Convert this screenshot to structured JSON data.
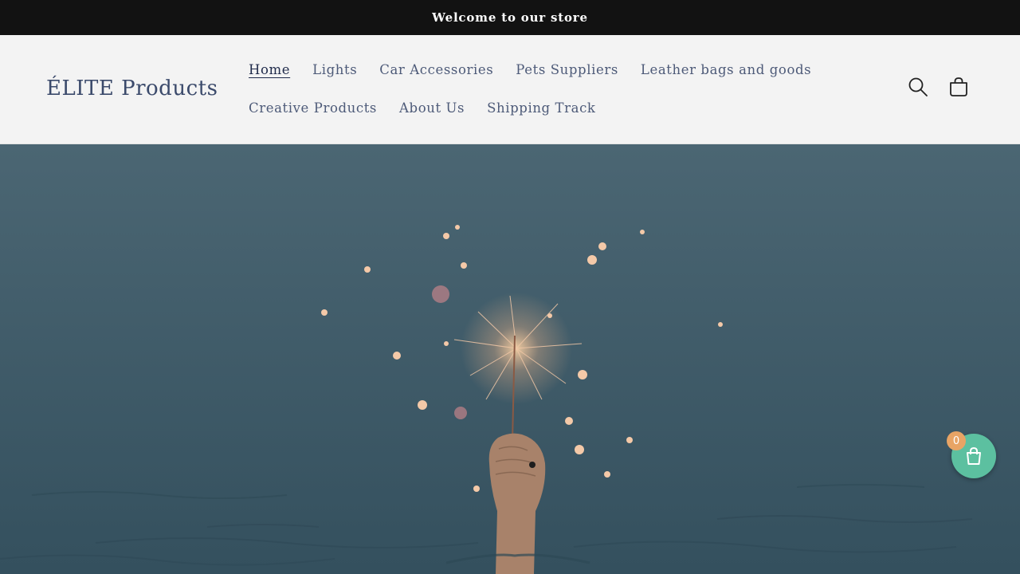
{
  "announcement": {
    "text": "Welcome to our store"
  },
  "header": {
    "logo": "ÉLITE Products",
    "nav_row1": [
      {
        "label": "Home",
        "active": true
      },
      {
        "label": "Lights"
      },
      {
        "label": "Car Accessories"
      },
      {
        "label": "Pets Suppliers"
      },
      {
        "label": "Leather bags and goods"
      }
    ],
    "nav_row2": [
      {
        "label": "Creative Products"
      },
      {
        "label": "About Us"
      },
      {
        "label": "Shipping Track"
      }
    ],
    "icons": {
      "search": "search-icon",
      "cart": "cart-icon"
    }
  },
  "hero": {
    "image": "hand-holding-sparkler-over-sea"
  },
  "floating_cart": {
    "count": "0",
    "icon": "shopping-bag-icon",
    "color": "#5cc0a0",
    "badge_color": "#e8a465"
  }
}
